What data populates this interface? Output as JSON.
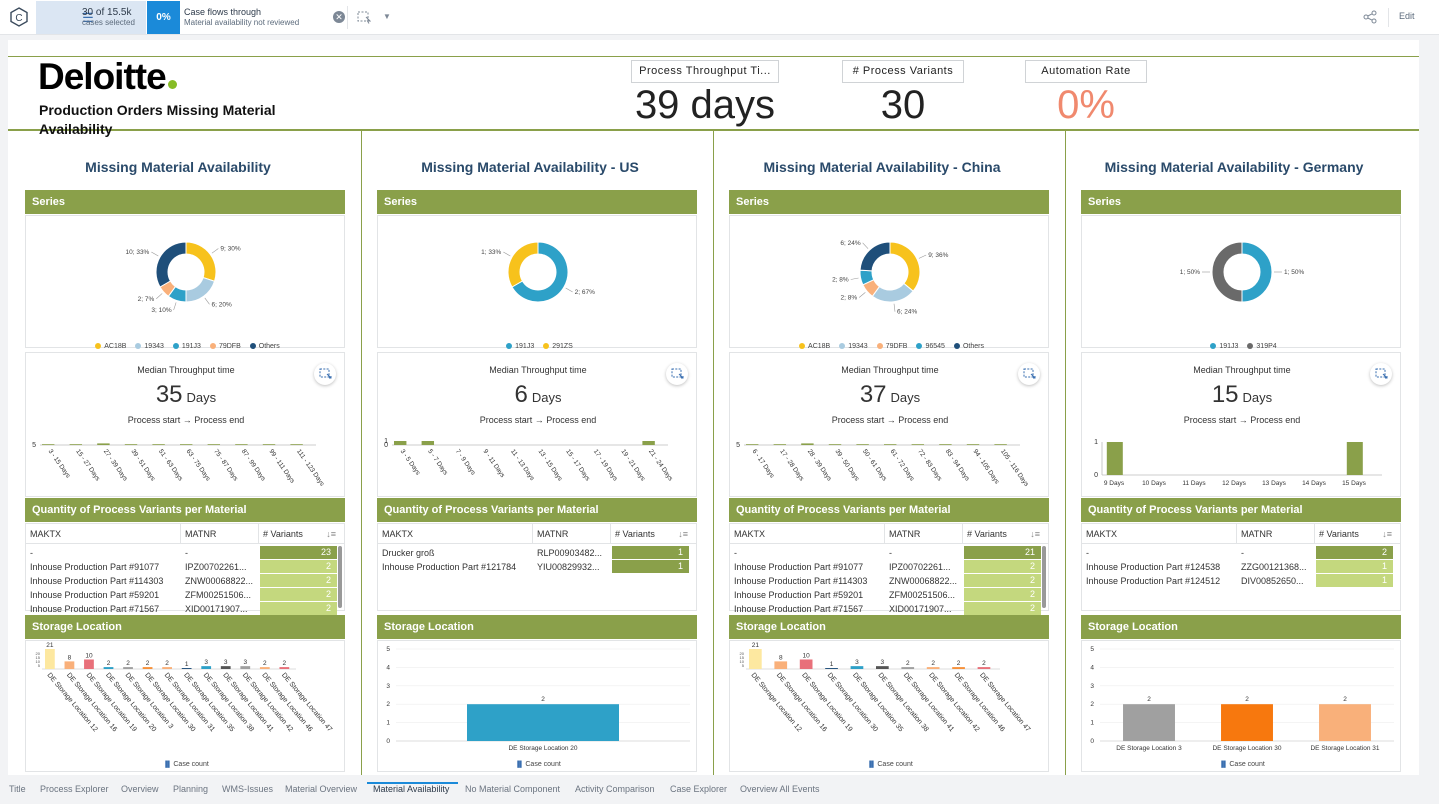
{
  "topbar": {
    "selection_count": "30 of 15.5k",
    "selection_sub": "cases selected",
    "pct": "0%",
    "flow_title": "Case flows through",
    "flow_sub": "Material availability not reviewed",
    "edit_label": "Edit"
  },
  "header": {
    "brand": "Deloitte",
    "title": "Production Orders Missing Material Availability",
    "kpis": [
      {
        "label": "Process Throughput Ti...",
        "value": "39 days"
      },
      {
        "label": "# Process Variants",
        "value": "30"
      },
      {
        "label": "Automation Rate",
        "value": "0%"
      }
    ],
    "automation_color": "#f0896e"
  },
  "labels": {
    "series": "Series",
    "median": "Median Throughput time",
    "days": "Days",
    "process_start": "Process start",
    "process_end": "Process end",
    "qty": "Quantity of Process Variants per Material",
    "storage": "Storage Location",
    "makt": "MAKTX",
    "matnr": "MATNR",
    "variants": "# Variants",
    "case_count": "Case count"
  },
  "colors": {
    "green": "#8aa04a",
    "yellow": "#f7c21c",
    "lightblue": "#a9cbe0",
    "teal": "#2ea1c8",
    "peach": "#f9b07a",
    "navy": "#1f4f7a",
    "gray": "#6a6a6a"
  },
  "columns": [
    {
      "title": "Missing Material Availability",
      "donut": {
        "slices": [
          {
            "name": "AC18B",
            "value": 9,
            "label": "9; 30%",
            "color": "#f7c21c"
          },
          {
            "name": "19343",
            "value": 6,
            "label": "6; 20%",
            "color": "#a9cbe0"
          },
          {
            "name": "191J3",
            "value": 3,
            "label": "3; 10%",
            "color": "#2ea1c8"
          },
          {
            "name": "79DFB",
            "value": 2,
            "label": "2; 7%",
            "color": "#f9b07a"
          },
          {
            "name": "Others",
            "value": 10,
            "label": "10; 33%",
            "color": "#1f4f7a"
          }
        ]
      },
      "median_value": "35",
      "hist": {
        "ticks": [
          "3 - 15 Days",
          "15 - 27 Days",
          "27 - 39 Days",
          "39 - 51 Days",
          "51 - 63 Days",
          "63 - 75 Days",
          "75 - 87 Days",
          "87 - 99 Days",
          "99 - 111 Days",
          "111 - 123 Days"
        ],
        "values": [
          1,
          1,
          2,
          1,
          1,
          1,
          1,
          1,
          1,
          1
        ],
        "ymax": 5,
        "yticks": [
          "5"
        ]
      },
      "table": [
        {
          "makt": "-",
          "matnr": "-",
          "variants": "23"
        },
        {
          "makt": "Inhouse Production Part #91077",
          "matnr": "IPZ00702261...",
          "variants": "2"
        },
        {
          "makt": "Inhouse Production Part #114303",
          "matnr": "ZNW00068822...",
          "variants": "2"
        },
        {
          "makt": "Inhouse Production Part #59201",
          "matnr": "ZFM00251506...",
          "variants": "2"
        },
        {
          "makt": "Inhouse Production Part #71567",
          "matnr": "XID00171907...",
          "variants": "2"
        }
      ],
      "table_max": 23,
      "storage": {
        "compact": true,
        "categories": [
          "DE Storage Location 12",
          "DE Storage Location 16",
          "DE Storage Location 19",
          "DE Storage Location 20",
          "DE Storage Location 3",
          "DE Storage Location 30",
          "DE Storage Location 31",
          "DE Storage Location 35",
          "DE Storage Location 38",
          "DE Storage Location 41",
          "DE Storage Location 42",
          "DE Storage Location 46",
          "DE Storage Location 47"
        ],
        "values": [
          21,
          8,
          10,
          2,
          2,
          2,
          2,
          1,
          3,
          3,
          3,
          2,
          2
        ],
        "colors": [
          "#fde8a0",
          "#f9b07a",
          "#e8707a",
          "#2ea1c8",
          "#a0a0a0",
          "#f7913a",
          "#f9b07a",
          "#1f4f7a",
          "#2ea1c8",
          "#555555",
          "#a0a0a0",
          "#f9b07a",
          "#e8707a"
        ],
        "ymax": 21
      }
    },
    {
      "title": "Missing Material Availability - US",
      "donut": {
        "slices": [
          {
            "name": "191J3",
            "value": 2,
            "label": "2; 67%",
            "color": "#2ea1c8"
          },
          {
            "name": "291ZS",
            "value": 1,
            "label": "1; 33%",
            "color": "#f7c21c"
          }
        ]
      },
      "median_value": "6",
      "hist": {
        "ticks": [
          "3 - 5 Days",
          "5 - 7 Days",
          "7 - 9 Days",
          "9 - 11 Days",
          "11 - 13 Days",
          "13 - 15 Days",
          "15 - 17 Days",
          "17 - 19 Days",
          "19 - 21 Days",
          "21 - 24 Days"
        ],
        "values": [
          1,
          1,
          0,
          0,
          0,
          0,
          0,
          0,
          0,
          1
        ],
        "ymax": 1,
        "yticks": [
          "1",
          "0"
        ]
      },
      "table": [
        {
          "makt": "Drucker groß",
          "matnr": "RLP00903482...",
          "variants": "1"
        },
        {
          "makt": "Inhouse Production Part #121784",
          "matnr": "YIU00829932...",
          "variants": "1"
        }
      ],
      "table_max": 1,
      "storage": {
        "compact": false,
        "categories": [
          "DE Storage Location 20"
        ],
        "values": [
          2
        ],
        "colors": [
          "#2ea1c8"
        ],
        "ymax": 5
      }
    },
    {
      "title": "Missing Material Availability - China",
      "donut": {
        "slices": [
          {
            "name": "AC18B",
            "value": 9,
            "label": "9; 36%",
            "color": "#f7c21c"
          },
          {
            "name": "19343",
            "value": 6,
            "label": "6; 24%",
            "color": "#a9cbe0"
          },
          {
            "name": "79DFB",
            "value": 2,
            "label": "2; 8%",
            "color": "#f9b07a"
          },
          {
            "name": "96545",
            "value": 2,
            "label": "2; 8%",
            "color": "#2ea1c8"
          },
          {
            "name": "Others",
            "value": 6,
            "label": "6; 24%",
            "color": "#1f4f7a"
          }
        ]
      },
      "median_value": "37",
      "hist": {
        "ticks": [
          "6 - 17 Days",
          "17 - 28 Days",
          "28 - 39 Days",
          "39 - 50 Days",
          "50 - 61 Days",
          "61 - 72 Days",
          "72 - 83 Days",
          "83 - 94 Days",
          "94 - 105 Days",
          "105 - 116 Days"
        ],
        "values": [
          1,
          1,
          2,
          1,
          1,
          1,
          1,
          1,
          1,
          1
        ],
        "ymax": 5,
        "yticks": [
          "5"
        ]
      },
      "table": [
        {
          "makt": "-",
          "matnr": "-",
          "variants": "21"
        },
        {
          "makt": "Inhouse Production Part #91077",
          "matnr": "IPZ00702261...",
          "variants": "2"
        },
        {
          "makt": "Inhouse Production Part #114303",
          "matnr": "ZNW00068822...",
          "variants": "2"
        },
        {
          "makt": "Inhouse Production Part #59201",
          "matnr": "ZFM00251506...",
          "variants": "2"
        },
        {
          "makt": "Inhouse Production Part #71567",
          "matnr": "XID00171907...",
          "variants": "2"
        }
      ],
      "table_max": 21,
      "storage": {
        "compact": true,
        "categories": [
          "DE Storage Location 12",
          "DE Storage Location 16",
          "DE Storage Location 19",
          "DE Storage Location 30",
          "DE Storage Location 35",
          "DE Storage Location 38",
          "DE Storage Location 41",
          "DE Storage Location 42",
          "DE Storage Location 46",
          "DE Storage Location 47"
        ],
        "values": [
          21,
          8,
          10,
          1,
          3,
          3,
          2,
          2,
          2,
          2
        ],
        "colors": [
          "#fde8a0",
          "#f9b07a",
          "#e8707a",
          "#1f4f7a",
          "#2ea1c8",
          "#555555",
          "#a0a0a0",
          "#f9b07a",
          "#f7913a",
          "#e8707a"
        ],
        "ymax": 21
      }
    },
    {
      "title": "Missing Material Availability - Germany",
      "donut": {
        "slices": [
          {
            "name": "191J3",
            "value": 1,
            "label": "1; 50%",
            "color": "#2ea1c8"
          },
          {
            "name": "319P4",
            "value": 1,
            "label": "1; 50%",
            "color": "#6a6a6a"
          }
        ]
      },
      "median_value": "15",
      "hist": {
        "ticks": [
          "9 Days",
          "10 Days",
          "11 Days",
          "12 Days",
          "13 Days",
          "14 Days",
          "15 Days"
        ],
        "values": [
          1,
          0,
          0,
          0,
          0,
          0,
          1
        ],
        "ymax": 1,
        "yticks": [
          "1",
          "0"
        ],
        "flat": true
      },
      "table": [
        {
          "makt": "-",
          "matnr": "-",
          "variants": "2"
        },
        {
          "makt": "Inhouse Production Part #124538",
          "matnr": "ZZG00121368...",
          "variants": "1"
        },
        {
          "makt": "Inhouse Production Part #124512",
          "matnr": "DIV00852650...",
          "variants": "1"
        }
      ],
      "table_max": 2,
      "storage": {
        "compact": false,
        "categories": [
          "DE Storage Location 3",
          "DE Storage Location 30",
          "DE Storage Location 31"
        ],
        "values": [
          2,
          2,
          2
        ],
        "colors": [
          "#a0a0a0",
          "#f7780e",
          "#f9b07a"
        ],
        "ymax": 5
      }
    }
  ],
  "tabs": [
    "Title",
    "Process Explorer",
    "Overview",
    "Planning",
    "WMS-Issues",
    "Material Overview",
    "Material Availability",
    "No Material Component",
    "Activity Comparison",
    "Case Explorer",
    "Overview All Events"
  ],
  "active_tab": "Material Availability"
}
